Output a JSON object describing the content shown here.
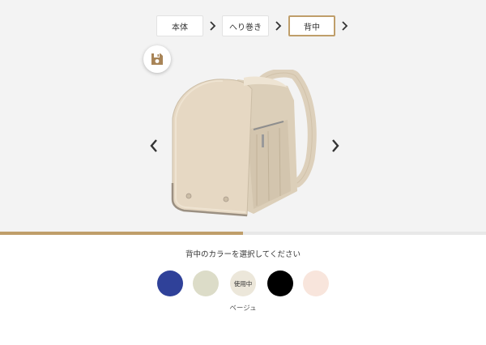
{
  "steps": [
    {
      "label": "本体"
    },
    {
      "label": "へり巻き"
    },
    {
      "label": "背中",
      "active": true
    }
  ],
  "icons": {
    "save": "floppy-disk-icon",
    "prev": "chevron-left-icon",
    "next": "chevron-right-icon",
    "step_next": "chevron-right-icon"
  },
  "progress": 0.5,
  "prompt": "背中のカラーを選択してください",
  "swatches": [
    {
      "color": "#2f4199",
      "label": ""
    },
    {
      "color": "#dcdcc8",
      "label": ""
    },
    {
      "color": "#ece7da",
      "label": "使用中",
      "selected": true
    },
    {
      "color": "#000000",
      "label": ""
    },
    {
      "color": "#f8e5dc",
      "label": ""
    }
  ],
  "selected_color_name": "ベージュ",
  "colors": {
    "accent": "#bf9e6a",
    "background": "#f3f3f3",
    "bag": "#e6d8c3"
  }
}
